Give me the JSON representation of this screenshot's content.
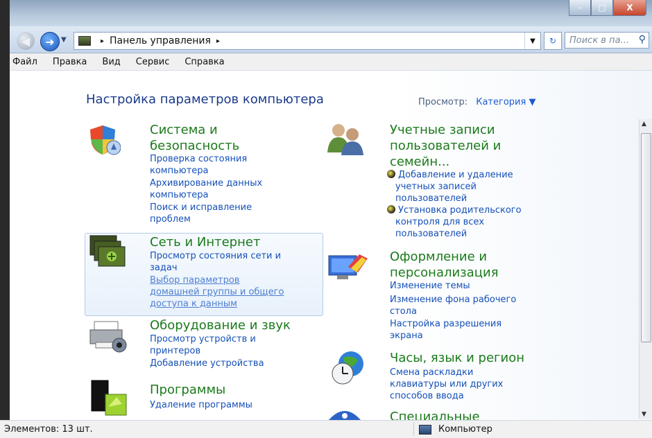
{
  "window": {
    "minimize": "–",
    "maximize": "□",
    "close": "X"
  },
  "address": {
    "path_root": "Панель управления",
    "separator": "▸"
  },
  "search": {
    "placeholder": "Поиск в па..."
  },
  "menu": [
    "Файл",
    "Правка",
    "Вид",
    "Сервис",
    "Справка"
  ],
  "page_title": "Настройка параметров компьютера",
  "view": {
    "label": "Просмотр:",
    "value": "Категория"
  },
  "categories": [
    {
      "title": [
        "Система и",
        "безопасность"
      ],
      "links": [
        [
          "Проверка состояния",
          "компьютера"
        ],
        [
          "Архивирование данных",
          "компьютера"
        ],
        [
          "Поиск и исправление",
          "проблем"
        ]
      ]
    },
    {
      "title": [
        "Сеть и Интернет"
      ],
      "links": [
        [
          "Просмотр состояния сети и",
          "задач"
        ],
        [
          "Выбор параметров",
          "домашней группы и общего",
          "доступа к данным"
        ]
      ]
    },
    {
      "title": [
        "Оборудование и звук"
      ],
      "links": [
        [
          "Просмотр устройств и",
          "принтеров"
        ],
        [
          "Добавление устройства"
        ]
      ]
    },
    {
      "title": [
        "Программы"
      ],
      "links": [
        [
          "Удаление программы"
        ]
      ]
    },
    {
      "title": [
        "Учетные записи",
        "пользователей и",
        "семейн..."
      ],
      "links": [
        [
          "Добавление и удаление",
          "учетных записей",
          "пользователей"
        ],
        [
          "Установка родительского",
          "контроля для всех",
          "пользователей"
        ]
      ]
    },
    {
      "title": [
        "Оформление и",
        "персонализация"
      ],
      "links": [
        [
          "Изменение темы"
        ],
        [
          "Изменение фона рабочего",
          "стола"
        ],
        [
          "Настройка разрешения",
          "экрана"
        ]
      ]
    },
    {
      "title": [
        "Часы, язык и регион"
      ],
      "links": [
        [
          "Смена раскладки",
          "клавиатуры или других",
          "способов ввода"
        ]
      ]
    },
    {
      "title": [
        "Специальные"
      ]
    }
  ],
  "status": {
    "items": "Элементов: 13 шт.",
    "location": "Компьютер"
  }
}
